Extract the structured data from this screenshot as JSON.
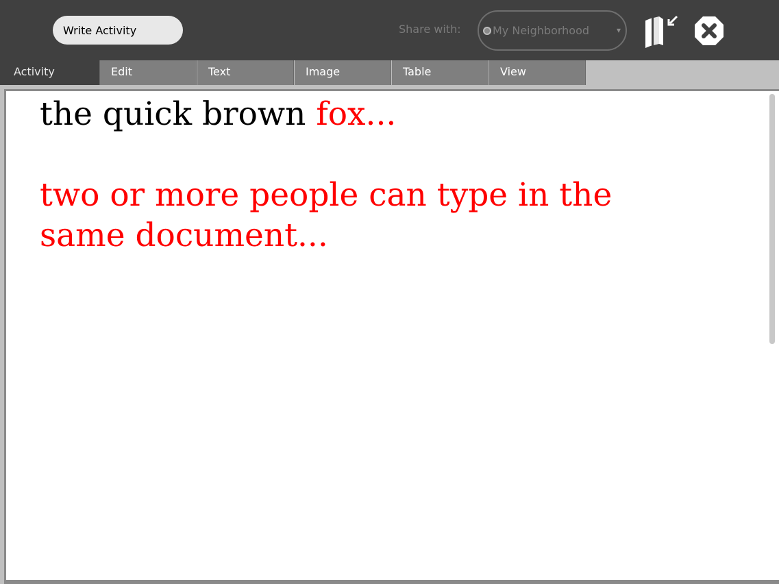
{
  "toolbar": {
    "title_value": "Write Activity",
    "share_label": "Share with:",
    "share_value": "My Neighborhood",
    "keep_icon": "keep-journal-icon",
    "stop_icon": "stop-icon"
  },
  "tabs": [
    {
      "label": "Activity"
    },
    {
      "label": "Edit"
    },
    {
      "label": "Text"
    },
    {
      "label": "Image"
    },
    {
      "label": "Table"
    },
    {
      "label": "View"
    }
  ],
  "document": {
    "line1_black": "the quick brown ",
    "line1_red": "fox...",
    "line2_red": "two or more people can type in the",
    "line3_red": "same document..."
  },
  "colors": {
    "toolbar_bg": "#404040",
    "tab_inactive": "#7f7f7f",
    "collaborator_text": "#ff0000"
  }
}
